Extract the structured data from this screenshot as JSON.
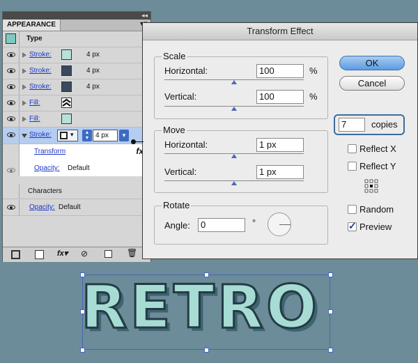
{
  "appearance": {
    "tab_label": "APPEARANCE",
    "object_type": "Type",
    "rows": [
      {
        "label": "Stroke:",
        "value": "4 px",
        "swatch": "#b9e1d8"
      },
      {
        "label": "Stroke:",
        "value": "4 px",
        "swatch": "#3a4a5e"
      },
      {
        "label": "Stroke:",
        "value": "4 px",
        "swatch": "#3a4a5e"
      },
      {
        "label": "Fill:",
        "swatch_icon": "chevron-pattern-icon"
      },
      {
        "label": "Fill:",
        "swatch": "#b9e1d8"
      }
    ],
    "selected_row": {
      "label": "Stroke:",
      "weight": "4 px"
    },
    "sub_items": {
      "transform": "Transform",
      "fx": "fx",
      "opacity_label": "Opacity:",
      "opacity_value": "Default"
    },
    "characters": "Characters",
    "bottom_opacity": {
      "label": "Opacity:",
      "value": "Default"
    },
    "bottom_icons": [
      "add-stroke-icon",
      "add-fill-icon",
      "fx-icon",
      "clear-icon",
      "duplicate-icon",
      "trash-icon"
    ]
  },
  "dialog": {
    "title": "Transform Effect",
    "scale": {
      "title": "Scale",
      "h_label": "Horizontal:",
      "h_value": "100",
      "h_unit": "%",
      "v_label": "Vertical:",
      "v_value": "100",
      "v_unit": "%"
    },
    "move": {
      "title": "Move",
      "h_label": "Horizontal:",
      "h_value": "1 px",
      "v_label": "Vertical:",
      "v_value": "1 px"
    },
    "rotate": {
      "title": "Rotate",
      "angle_label": "Angle:",
      "angle_value": "0",
      "degree": "°"
    },
    "ok": "OK",
    "cancel": "Cancel",
    "copies_value": "7",
    "copies_label": "copies",
    "reflect_x": "Reflect X",
    "reflect_y": "Reflect Y",
    "random": "Random",
    "preview": "Preview",
    "checked": {
      "reflect_x": false,
      "reflect_y": false,
      "random": false,
      "preview": true
    }
  },
  "canvas_text": "RETRO",
  "colors": {
    "background": "#6b8c98",
    "accent": "#4a68b6",
    "ok_button": "#5c9be2"
  }
}
